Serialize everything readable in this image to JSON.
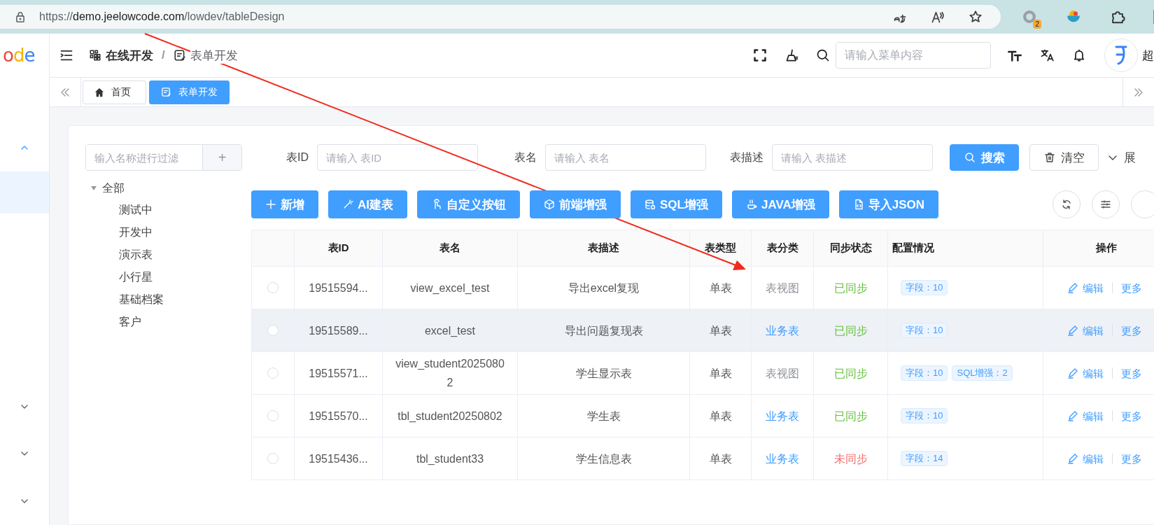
{
  "browser": {
    "url_scheme": "https://",
    "url_host": "demo.jeelowcode.com",
    "url_path": "/lowdev/tableDesign",
    "extension_badge": "2"
  },
  "logo": {
    "letters": [
      {
        "text": "o",
        "color": "#e8453c"
      },
      {
        "text": "d",
        "color": "#f4b400"
      },
      {
        "text": "e",
        "color": "#3b82f6"
      }
    ]
  },
  "header": {
    "breadcrumb": [
      "在线开发",
      "表单开发"
    ],
    "separator": "/",
    "search": {
      "placeholder": "请输入菜单内容"
    },
    "user_name": "超"
  },
  "tabs": [
    {
      "label": "首页",
      "kind": "home",
      "selected": false
    },
    {
      "label": "表单开发",
      "kind": "form",
      "selected": true
    }
  ],
  "sidebar": {
    "items": [
      {
        "kind": "group",
        "expanded": true
      },
      {
        "kind": "item",
        "selected": true
      },
      {
        "kind": "group",
        "expanded": false
      },
      {
        "kind": "group",
        "expanded": false
      },
      {
        "kind": "group",
        "expanded": false
      }
    ]
  },
  "tree": {
    "filter": {
      "placeholder": "输入名称进行过滤"
    },
    "add_button": "+",
    "root": {
      "label": "全部",
      "expanded": true,
      "children": [
        {
          "label": "测试中"
        },
        {
          "label": "开发中"
        },
        {
          "label": "演示表"
        },
        {
          "label": "小行星"
        },
        {
          "label": "基础档案"
        },
        {
          "label": "客户"
        }
      ]
    }
  },
  "search_form": {
    "fields": [
      {
        "label": "表ID",
        "placeholder": "请输入 表ID"
      },
      {
        "label": "表名",
        "placeholder": "请输入 表名"
      },
      {
        "label": "表描述",
        "placeholder": "请输入 表描述"
      }
    ],
    "search_button": "搜索",
    "clear_button": "清空",
    "expand_link": "展"
  },
  "toolbar": {
    "buttons": [
      {
        "label": "新增",
        "kind": "plus"
      },
      {
        "label": "AI建表",
        "kind": "wand"
      },
      {
        "label": "自定义按钮",
        "kind": "hand"
      },
      {
        "label": "前端增强",
        "kind": "cube"
      },
      {
        "label": "SQL增强",
        "kind": "database"
      },
      {
        "label": "JAVA增强",
        "kind": "cup"
      },
      {
        "label": "导入JSON",
        "kind": "file"
      }
    ]
  },
  "table": {
    "columns": [
      "表ID",
      "表名",
      "表描述",
      "表类型",
      "表分类",
      "同步状态",
      "配置情况",
      "操作"
    ],
    "rows": [
      {
        "selected": false,
        "hovered": false,
        "id": "19515594...",
        "name": "view_excel_test",
        "description": "导出excel复现",
        "type": "单表",
        "category": {
          "label": "表视图",
          "color": "#909399"
        },
        "sync": {
          "label": "已同步",
          "color": "#67c23a"
        },
        "tags": [
          "字段：10"
        ],
        "actions": [
          "编辑",
          "更多"
        ]
      },
      {
        "selected": false,
        "hovered": true,
        "id": "19515589...",
        "name": "excel_test",
        "description": "导出问题复现表",
        "type": "单表",
        "category": {
          "label": "业务表",
          "color": "#409eff"
        },
        "sync": {
          "label": "已同步",
          "color": "#67c23a"
        },
        "tags": [
          "字段：10"
        ],
        "actions": [
          "编辑",
          "更多"
        ]
      },
      {
        "selected": false,
        "hovered": false,
        "id": "19515571...",
        "name": "view_student20250802",
        "description": "学生显示表",
        "type": "单表",
        "category": {
          "label": "表视图",
          "color": "#909399"
        },
        "sync": {
          "label": "已同步",
          "color": "#67c23a"
        },
        "tags": [
          "字段：10",
          "SQL增强：2"
        ],
        "actions": [
          "编辑",
          "更多"
        ]
      },
      {
        "selected": false,
        "hovered": false,
        "id": "19515570...",
        "name": "tbl_student20250802",
        "description": "学生表",
        "type": "单表",
        "category": {
          "label": "业务表",
          "color": "#409eff"
        },
        "sync": {
          "label": "已同步",
          "color": "#67c23a"
        },
        "tags": [
          "字段：10"
        ],
        "actions": [
          "编辑",
          "更多"
        ]
      },
      {
        "selected": false,
        "hovered": false,
        "id": "19515436...",
        "name": "tbl_student33",
        "description": "学生信息表",
        "type": "单表",
        "category": {
          "label": "业务表",
          "color": "#409eff"
        },
        "sync": {
          "label": "未同步",
          "color": "#f56c6c"
        },
        "tags": [
          "字段：14"
        ],
        "actions": [
          "编辑",
          "更多"
        ]
      }
    ]
  },
  "annotations": [
    {
      "kind": "arrow"
    }
  ]
}
